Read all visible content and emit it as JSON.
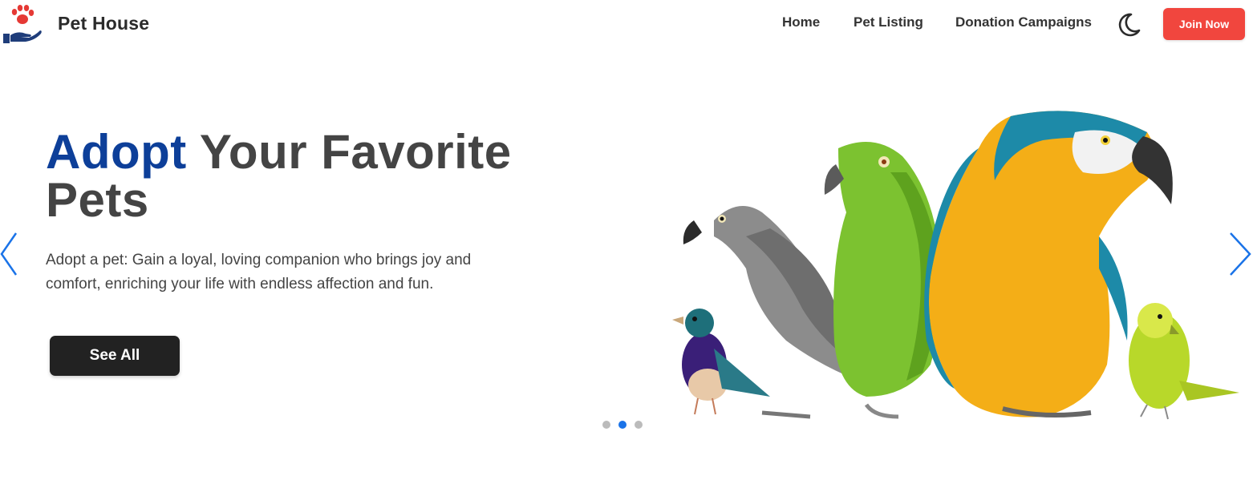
{
  "navbar": {
    "brand": "Pet House",
    "links": [
      "Home",
      "Pet Listing",
      "Donation Campaigns"
    ],
    "join_label": "Join Now",
    "theme_icon": "moon-icon",
    "logo_icon": "paw-hand-icon"
  },
  "hero": {
    "title_accent": "Adopt",
    "title_rest": " Your Favorite Pets",
    "description": "Adopt a pet: Gain a loyal, loving companion who brings joy and comfort, enriching your life with endless affection and fun.",
    "cta_label": "See All",
    "slides_total": 3,
    "active_slide": 2
  },
  "colors": {
    "accent": "#0d3f99",
    "join_button": "#f1463e",
    "cta_button": "#222222",
    "dot_active": "#1a73e8",
    "dot_inactive": "#bbbbbb",
    "arrow": "#1a73e8"
  }
}
